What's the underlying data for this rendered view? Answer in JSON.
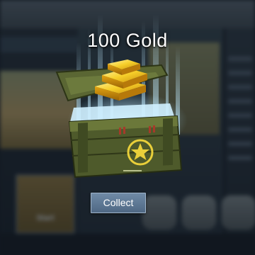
{
  "reward": {
    "title": "100 Gold",
    "icon": "gold-bars-icon"
  },
  "actions": {
    "collect_label": "Collect"
  },
  "background": {
    "map_card_label": "Start",
    "crate_emblem": "star-emblem-icon"
  },
  "colors": {
    "button": "#5b7593",
    "gold": "#f2c21a",
    "crate": "#4e5a2b",
    "rays": "#bfeaff"
  }
}
